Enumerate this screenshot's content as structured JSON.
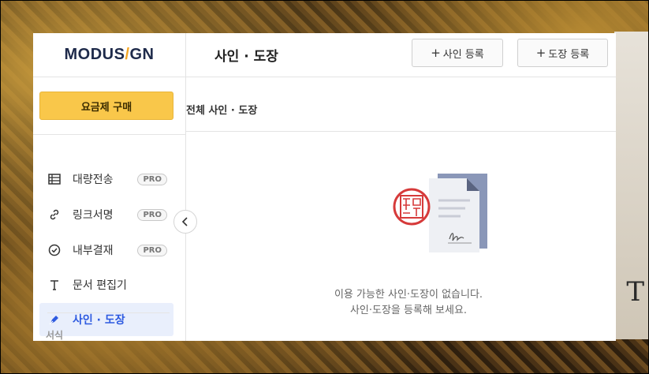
{
  "app": {
    "logo": {
      "part1": "MODUS",
      "slash": "/",
      "part2": "GN"
    },
    "page_title": "사인 · 도장"
  },
  "toolbar": {
    "add_sign_label": "사인 등록",
    "add_stamp_label": "도장 등록",
    "plus_glyph": "+"
  },
  "sidebar": {
    "buy_label": "요금제 구매",
    "items": [
      {
        "label": "대량전송",
        "icon": "table-icon",
        "badge": "PRO"
      },
      {
        "label": "링크서명",
        "icon": "link-icon",
        "badge": "PRO"
      },
      {
        "label": "내부결재",
        "icon": "check-circle-icon",
        "badge": "PRO"
      },
      {
        "label": "문서 편집기",
        "icon": "text-icon",
        "badge": ""
      },
      {
        "label": "사인 · 도장",
        "icon": "pen-icon",
        "badge": "",
        "active": true
      }
    ],
    "section_label": "서식"
  },
  "main": {
    "filter_title": "전체 사인 · 도장",
    "empty_line1": "이용 가능한 사인·도장이 없습니다.",
    "empty_line2": "사인·도장을 등록해 보세요."
  },
  "colors": {
    "accent": "#2d5ae0",
    "buy_button": "#f9c74a",
    "stamp_red": "#d63a3a"
  }
}
